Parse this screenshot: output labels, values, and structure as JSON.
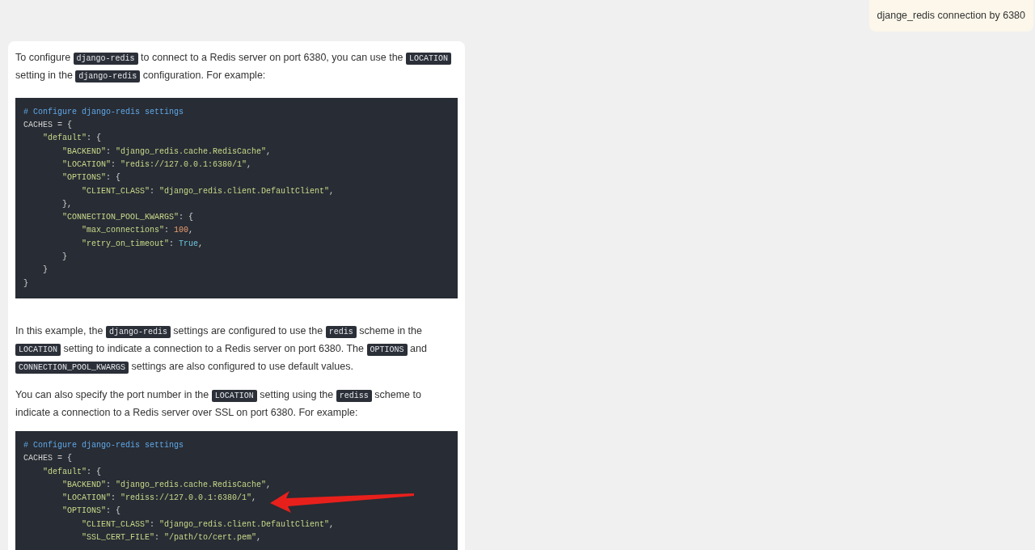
{
  "user_message": {
    "text": "djange_redis connection by 6380"
  },
  "answer": {
    "blocks": [
      {
        "kind": "paragraph",
        "segments": [
          {
            "kind": "text",
            "text": "To configure "
          },
          {
            "kind": "code",
            "text": "django-redis"
          },
          {
            "kind": "text",
            "text": " to connect to a Redis server on port 6380, you can use the "
          },
          {
            "kind": "code",
            "text": "LOCATION"
          },
          {
            "kind": "text",
            "text": " setting in the "
          },
          {
            "kind": "code",
            "text": "django-redis"
          },
          {
            "kind": "text",
            "text": " configuration. For example:"
          }
        ]
      },
      {
        "kind": "code",
        "lines": [
          [
            {
              "kind": "comment",
              "text": "# Configure django-redis settings"
            }
          ],
          [
            {
              "kind": "plain",
              "text": "CACHES = {"
            }
          ],
          [
            {
              "kind": "string",
              "text": "    \"default\""
            },
            {
              "kind": "plain",
              "text": ": {"
            }
          ],
          [
            {
              "kind": "string",
              "text": "        \"BACKEND\""
            },
            {
              "kind": "plain",
              "text": ": "
            },
            {
              "kind": "string",
              "text": "\"django_redis.cache.RedisCache\""
            },
            {
              "kind": "plain",
              "text": ","
            }
          ],
          [
            {
              "kind": "string",
              "text": "        \"LOCATION\""
            },
            {
              "kind": "plain",
              "text": ": "
            },
            {
              "kind": "string",
              "text": "\"redis://127.0.0.1:6380/1\""
            },
            {
              "kind": "plain",
              "text": ","
            }
          ],
          [
            {
              "kind": "string",
              "text": "        \"OPTIONS\""
            },
            {
              "kind": "plain",
              "text": ": {"
            }
          ],
          [
            {
              "kind": "string",
              "text": "            \"CLIENT_CLASS\""
            },
            {
              "kind": "plain",
              "text": ": "
            },
            {
              "kind": "string",
              "text": "\"django_redis.client.DefaultClient\""
            },
            {
              "kind": "plain",
              "text": ","
            }
          ],
          [
            {
              "kind": "plain",
              "text": "        },"
            }
          ],
          [
            {
              "kind": "string",
              "text": "        \"CONNECTION_POOL_KWARGS\""
            },
            {
              "kind": "plain",
              "text": ": {"
            }
          ],
          [
            {
              "kind": "string",
              "text": "            \"max_connections\""
            },
            {
              "kind": "plain",
              "text": ": "
            },
            {
              "kind": "number",
              "text": "100"
            },
            {
              "kind": "plain",
              "text": ","
            }
          ],
          [
            {
              "kind": "string",
              "text": "            \"retry_on_timeout\""
            },
            {
              "kind": "plain",
              "text": ": "
            },
            {
              "kind": "literal",
              "text": "True"
            },
            {
              "kind": "plain",
              "text": ","
            }
          ],
          [
            {
              "kind": "plain",
              "text": "        }"
            }
          ],
          [
            {
              "kind": "plain",
              "text": "    }"
            }
          ],
          [
            {
              "kind": "plain",
              "text": "}"
            }
          ]
        ]
      },
      {
        "kind": "paragraph",
        "segments": [
          {
            "kind": "text",
            "text": "In this example, the "
          },
          {
            "kind": "code",
            "text": "django-redis"
          },
          {
            "kind": "text",
            "text": " settings are configured to use the "
          },
          {
            "kind": "code",
            "text": "redis"
          },
          {
            "kind": "text",
            "text": " scheme in the "
          },
          {
            "kind": "code",
            "text": "LOCATION"
          },
          {
            "kind": "text",
            "text": " setting to indicate a connection to a Redis server on port 6380. The "
          },
          {
            "kind": "code",
            "text": "OPTIONS"
          },
          {
            "kind": "text",
            "text": " and "
          },
          {
            "kind": "code",
            "text": "CONNECTION_POOL_KWARGS"
          },
          {
            "kind": "text",
            "text": " settings are also configured to use default values."
          }
        ]
      },
      {
        "kind": "paragraph",
        "segments": [
          {
            "kind": "text",
            "text": "You can also specify the port number in the "
          },
          {
            "kind": "code",
            "text": "LOCATION"
          },
          {
            "kind": "text",
            "text": " setting using the "
          },
          {
            "kind": "code",
            "text": "rediss"
          },
          {
            "kind": "text",
            "text": " scheme to indicate a connection to a Redis server over SSL on port 6380. For example:"
          }
        ]
      },
      {
        "kind": "code",
        "lines": [
          [
            {
              "kind": "comment",
              "text": "# Configure django-redis settings"
            }
          ],
          [
            {
              "kind": "plain",
              "text": "CACHES = {"
            }
          ],
          [
            {
              "kind": "string",
              "text": "    \"default\""
            },
            {
              "kind": "plain",
              "text": ": {"
            }
          ],
          [
            {
              "kind": "string",
              "text": "        \"BACKEND\""
            },
            {
              "kind": "plain",
              "text": ": "
            },
            {
              "kind": "string",
              "text": "\"django_redis.cache.RedisCache\""
            },
            {
              "kind": "plain",
              "text": ","
            }
          ],
          [
            {
              "kind": "string",
              "text": "        \"LOCATION\""
            },
            {
              "kind": "plain",
              "text": ": "
            },
            {
              "kind": "string",
              "text": "\"rediss://127.0.0.1:6380/1\""
            },
            {
              "kind": "plain",
              "text": ","
            }
          ],
          [
            {
              "kind": "string",
              "text": "        \"OPTIONS\""
            },
            {
              "kind": "plain",
              "text": ": {"
            }
          ],
          [
            {
              "kind": "string",
              "text": "            \"CLIENT_CLASS\""
            },
            {
              "kind": "plain",
              "text": ": "
            },
            {
              "kind": "string",
              "text": "\"django_redis.client.DefaultClient\""
            },
            {
              "kind": "plain",
              "text": ","
            }
          ],
          [
            {
              "kind": "string",
              "text": "            \"SSL_CERT_FILE\""
            },
            {
              "kind": "plain",
              "text": ": "
            },
            {
              "kind": "string",
              "text": "\"/path/to/cert.pem\""
            },
            {
              "kind": "plain",
              "text": ","
            }
          ]
        ]
      }
    ]
  }
}
